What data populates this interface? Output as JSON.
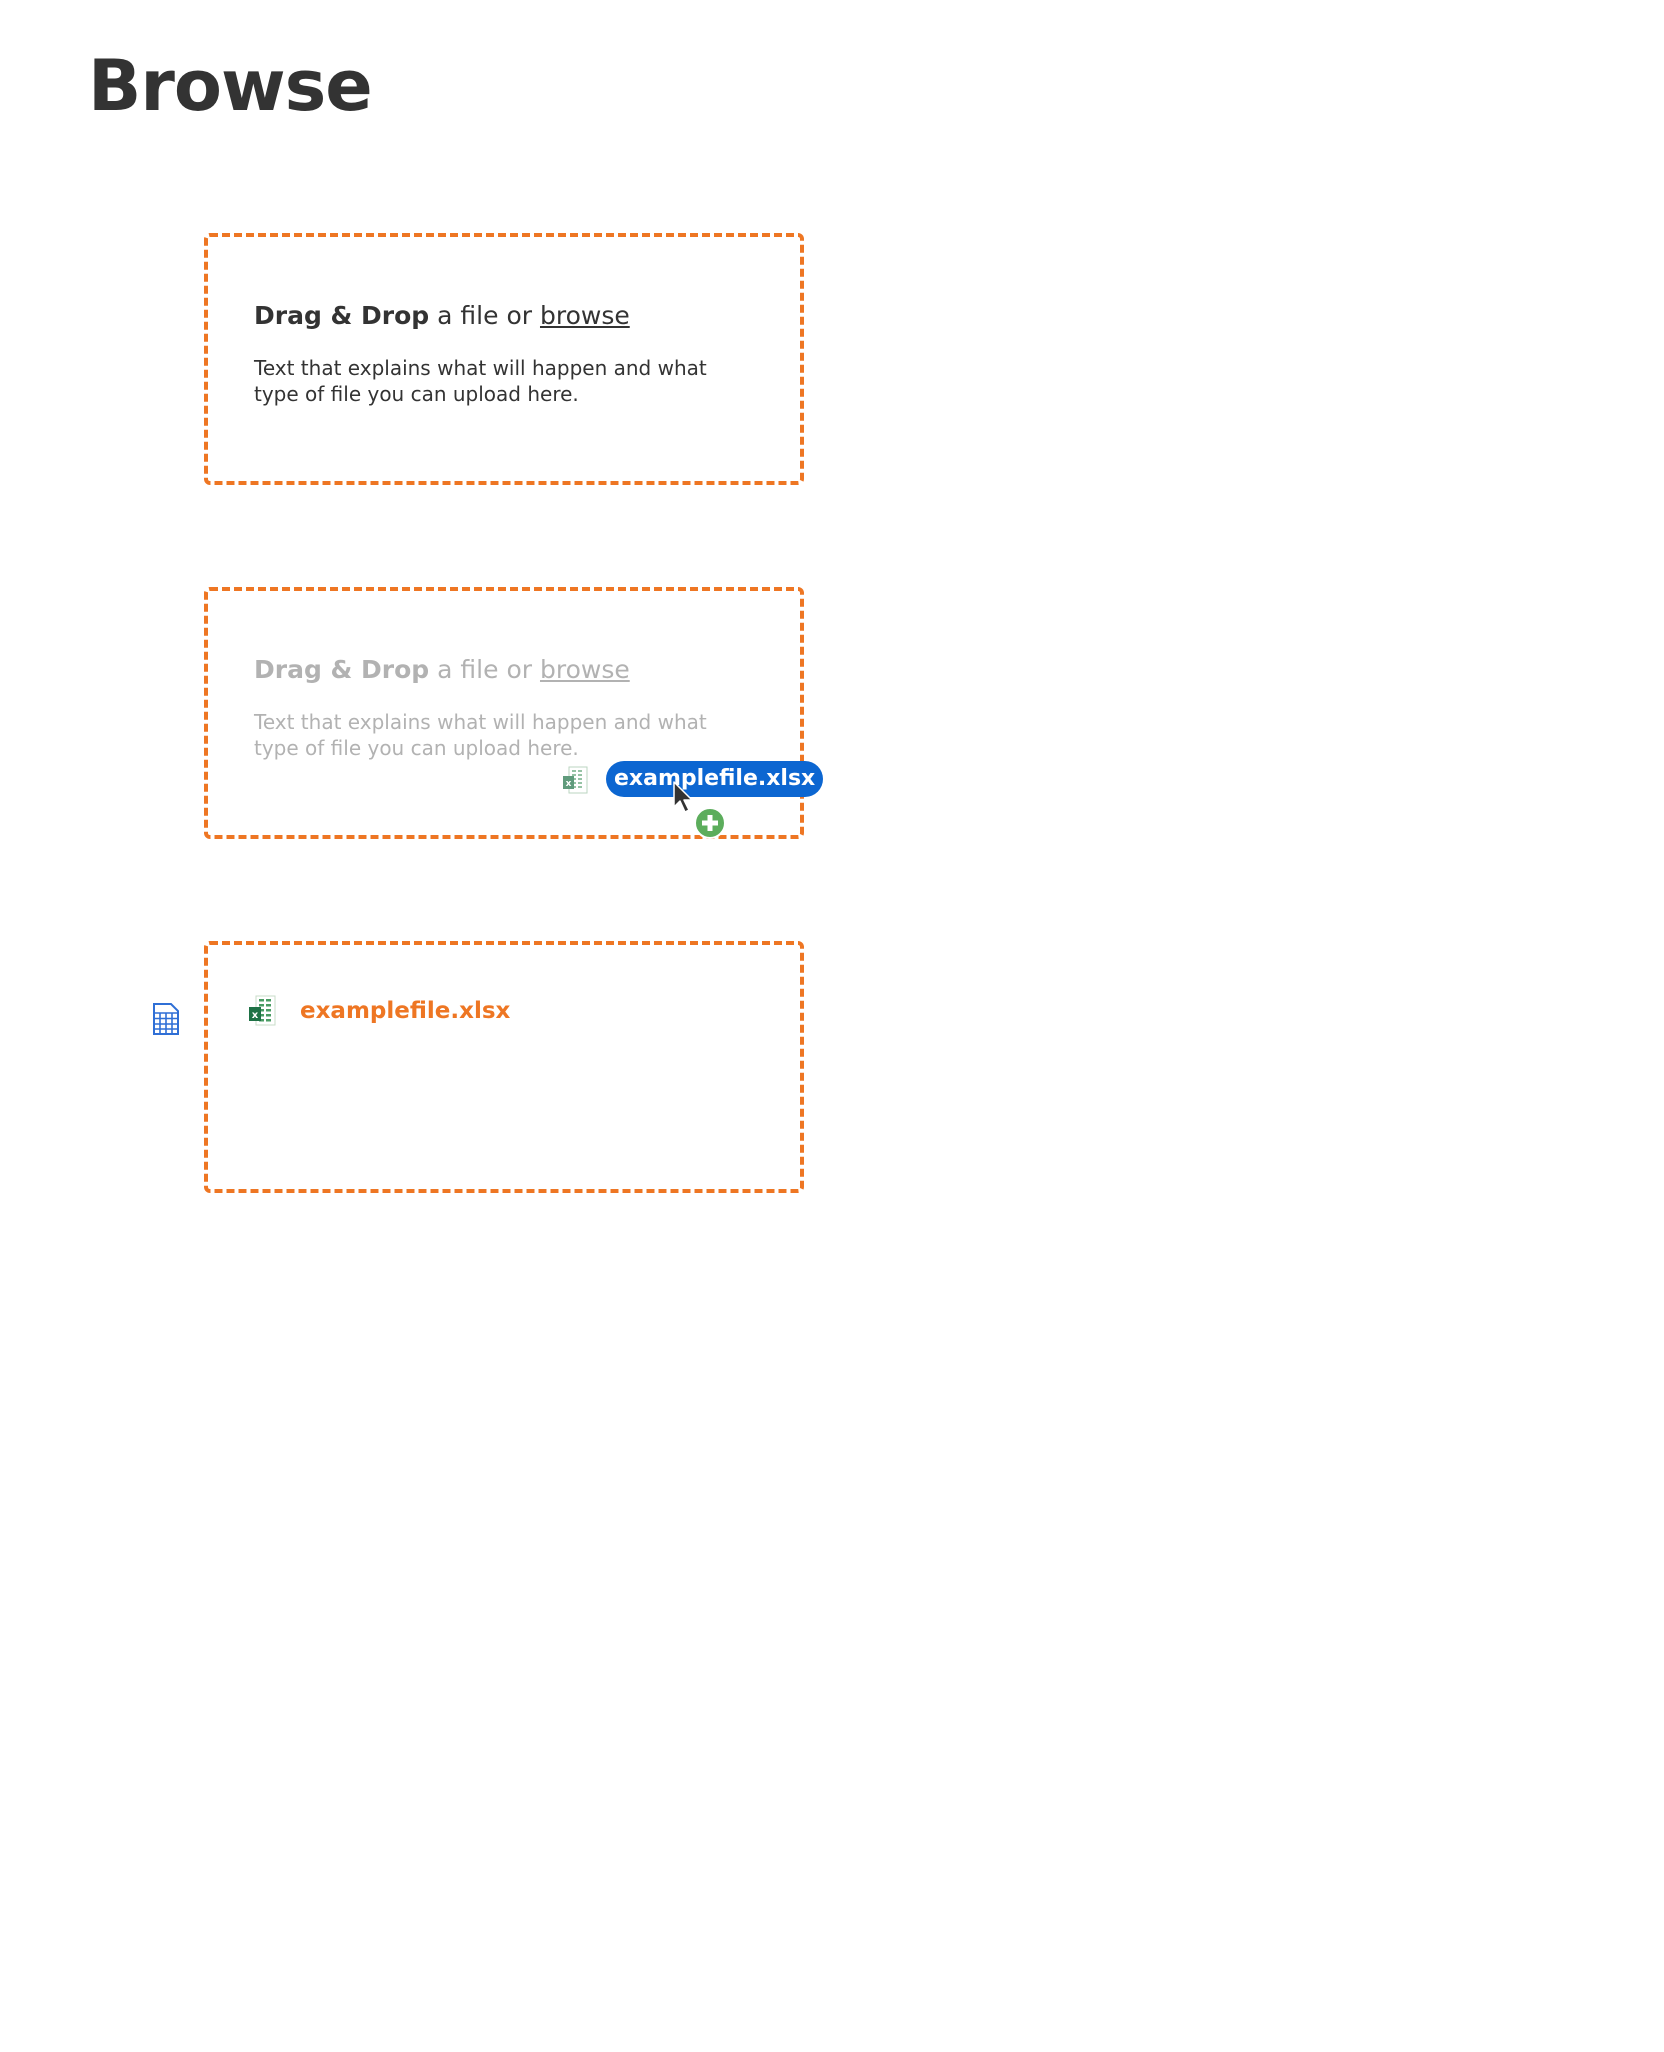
{
  "page": {
    "title": "Browse"
  },
  "dropzones": [
    {
      "state": "default",
      "heading_strong": "Drag & Drop",
      "heading_mid": " a file or ",
      "heading_link": "browse",
      "description": "Text that explains what will happen and what type of file you can upload here."
    },
    {
      "state": "drag-over",
      "heading_strong": "Drag & Drop",
      "heading_mid": " a file or ",
      "heading_link": "browse",
      "description": "Text that explains what will happen and what type of file you can upload here.",
      "dragged_file": "examplefile.xlsx"
    },
    {
      "state": "uploaded",
      "file_name": "examplefile.xlsx"
    }
  ],
  "colors": {
    "accent_orange": "#ee7623",
    "drag_pill_blue": "#0c66d1",
    "add_badge_green": "#5cad5c",
    "excel_green": "#1e7145",
    "grid_blue": "#2f6fd6"
  },
  "icons": {
    "file_type": "excel-file-icon",
    "drag_cursor": "cursor-arrow-icon",
    "drop_badge": "plus-circle-icon",
    "side_marker": "table-grid-icon"
  }
}
